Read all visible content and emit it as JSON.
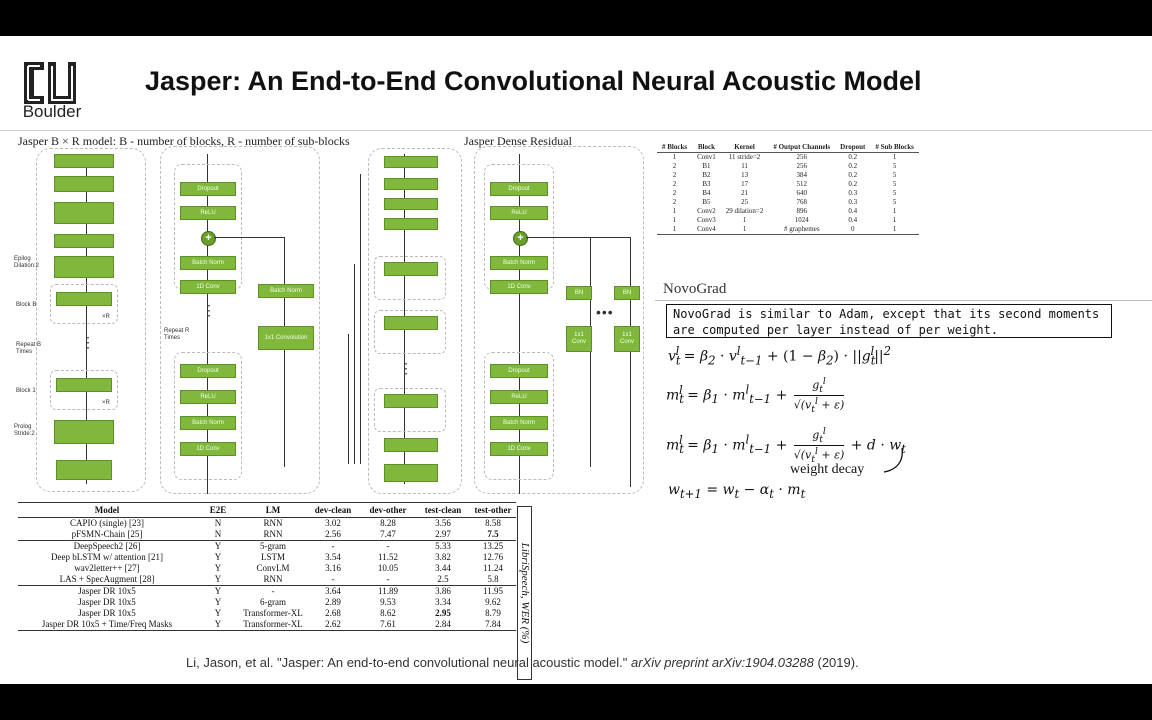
{
  "header": {
    "logo_text": "Boulder",
    "title": "Jasper: An End-to-End Convolutional Neural Acoustic Model"
  },
  "figure": {
    "left_caption": "Jasper B × R model: B - number of blocks, R - number of sub-blocks",
    "right_caption": "Jasper Dense Residual",
    "labels": {
      "epilog": "Epilog Dilation:2",
      "block_b": "Block B",
      "repeat_b": "Repeat B Times",
      "block_1": "Block 1",
      "prolog": "Prolog Stride:2",
      "repeat_r": "Repeat R Times",
      "xr": "×R",
      "dropout": "Dropout",
      "relu": "ReLU",
      "batch_norm": "Batch Norm",
      "conv_1d": "1D Conv",
      "conv_1x1": "1x1 Convolution",
      "bn": "BN",
      "conv_1x1_short": "1x1 Conv"
    }
  },
  "arch_table": {
    "headers": [
      "# Blocks",
      "Block",
      "Kernel",
      "# Output Channels",
      "Dropout",
      "# Sub Blocks"
    ],
    "rows": [
      [
        "1",
        "Conv1",
        "11 stride=2",
        "256",
        "0.2",
        "1"
      ],
      [
        "2",
        "B1",
        "11",
        "256",
        "0.2",
        "5"
      ],
      [
        "2",
        "B2",
        "13",
        "384",
        "0.2",
        "5"
      ],
      [
        "2",
        "B3",
        "17",
        "512",
        "0.2",
        "5"
      ],
      [
        "2",
        "B4",
        "21",
        "640",
        "0.3",
        "5"
      ],
      [
        "2",
        "B5",
        "25",
        "768",
        "0.3",
        "5"
      ],
      [
        "1",
        "Conv2",
        "29 dilation=2",
        "896",
        "0.4",
        "1"
      ],
      [
        "1",
        "Conv3",
        "1",
        "1024",
        "0.4",
        "1"
      ],
      [
        "1",
        "Conv4",
        "1",
        "# graphemes",
        "0",
        "1"
      ]
    ]
  },
  "novograd": {
    "title": "NovoGrad",
    "description": "NovoGrad is similar to Adam, except that its second moments are computed per layer instead of per weight.",
    "weight_decay": "weight decay"
  },
  "wer_table": {
    "headers": [
      "Model",
      "E2E",
      "LM",
      "dev-clean",
      "dev-other",
      "test-clean",
      "test-other"
    ],
    "side_label": "LibriSpeech, WER (%)",
    "groups": [
      [
        [
          "CAPIO (single) [23]",
          "N",
          "RNN",
          "3.02",
          "8.28",
          "3.56",
          "8.58"
        ],
        [
          "pFSMN-Chain [25]",
          "N",
          "RNN",
          "2.56",
          "7.47",
          "2.97",
          "7.5"
        ]
      ],
      [
        [
          "DeepSpeech2 [26]",
          "Y",
          "5-gram",
          "-",
          "-",
          "5.33",
          "13.25"
        ],
        [
          "Deep bLSTM w/ attention [21]",
          "Y",
          "LSTM",
          "3.54",
          "11.52",
          "3.82",
          "12.76"
        ],
        [
          "wav2letter++ [27]",
          "Y",
          "ConvLM",
          "3.16",
          "10.05",
          "3.44",
          "11.24"
        ],
        [
          "LAS + SpecAugment [28]",
          "Y",
          "RNN",
          "-",
          "-",
          "2.5",
          "5.8"
        ]
      ],
      [
        [
          "Jasper DR 10x5",
          "Y",
          "-",
          "3.64",
          "11.89",
          "3.86",
          "11.95"
        ],
        [
          "Jasper DR 10x5",
          "Y",
          "6-gram",
          "2.89",
          "9.53",
          "3.34",
          "9.62"
        ],
        [
          "Jasper DR 10x5",
          "Y",
          "Transformer-XL",
          "2.68",
          "8.62",
          "2.95",
          "8.79"
        ],
        [
          "Jasper DR 10x5 + Time/Freq Masks",
          "Y",
          "Transformer-XL",
          "2.62",
          "7.61",
          "2.84",
          "7.84"
        ]
      ]
    ]
  },
  "citation": {
    "authors": "Li, Jason, et al. \"Jasper: An end-to-end convolutional neural acoustic model.\"",
    "venue": "arXiv preprint arXiv:1904.03288",
    "year": "(2019)."
  },
  "colors": {
    "block_green": "#7fb83a",
    "background": "#ffffff",
    "letterbox": "#000000"
  }
}
